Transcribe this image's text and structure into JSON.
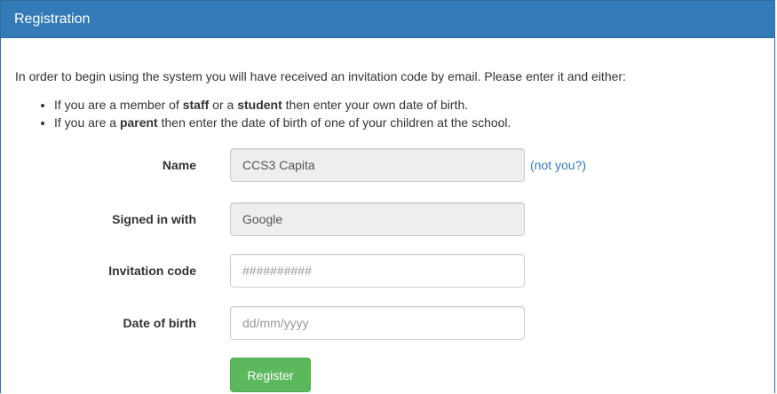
{
  "panel": {
    "title": "Registration",
    "intro": "In order to begin using the system you will have received an invitation code by email. Please enter it and either:",
    "bullets": [
      {
        "part1": "If you are a member of ",
        "bold1": "staff",
        "part2": " or a ",
        "bold2": "student",
        "part3": " then enter your own date of birth."
      },
      {
        "part1": "If you are a ",
        "bold1": "parent",
        "part2": " then enter the date of birth of one of your children at the school."
      }
    ]
  },
  "form": {
    "name": {
      "label": "Name",
      "value": "CCS3 Capita",
      "not_you": "(not you?)"
    },
    "signed_in_with": {
      "label": "Signed in with",
      "value": "Google"
    },
    "invitation_code": {
      "label": "Invitation code",
      "placeholder": "##########",
      "value": ""
    },
    "date_of_birth": {
      "label": "Date of birth",
      "placeholder": "dd/mm/yyyy",
      "value": ""
    },
    "register_label": "Register"
  },
  "colors": {
    "header_bg": "#337ab7",
    "register_bg": "#5cb85c",
    "link": "#337ab7",
    "readonly_bg": "#eeeeee"
  }
}
